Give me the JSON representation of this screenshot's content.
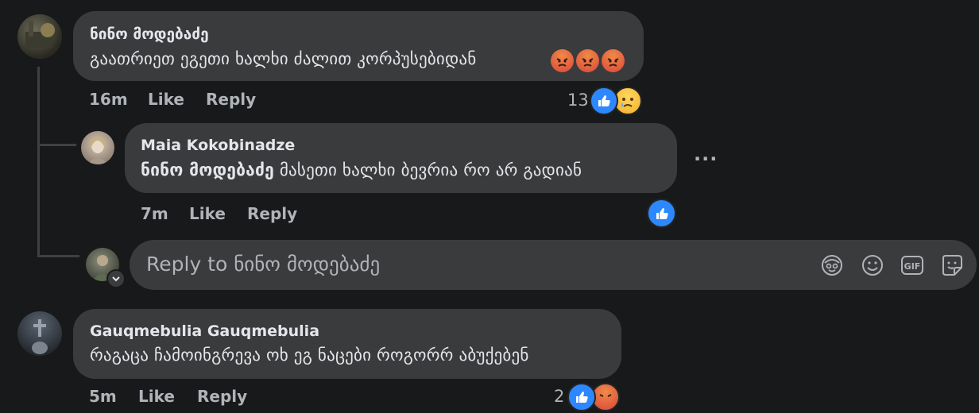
{
  "comments": [
    {
      "author": "ნინო მოდებაძე",
      "text": "გაათრიეთ ეგეთი ხალხი ძალით კორპუსებიდან",
      "time": "16m",
      "like_label": "Like",
      "reply_label": "Reply",
      "reaction_count": "13",
      "reactions": [
        "like",
        "sad"
      ],
      "inline_emojis": [
        "angry-face",
        "angry-face",
        "angry-face"
      ]
    },
    {
      "author": "Maia Kokobinadze",
      "mention": "ნინო მოდებაძე",
      "text": "მასეთი ხალხი ბევრია რო არ გადიან",
      "time": "7m",
      "like_label": "Like",
      "reply_label": "Reply",
      "reactions": [
        "like"
      ],
      "more_label": "..."
    },
    {
      "author": "Gauqmebulia Gauqmebulia",
      "text": "რაგაცა ჩამოინგრევა ოხ ეგ ნაცები როგორრ აბუქებენ",
      "time": "5m",
      "like_label": "Like",
      "reply_label": "Reply",
      "reaction_count": "2",
      "reactions": [
        "like",
        "angry"
      ]
    }
  ],
  "reply_box": {
    "placeholder": "Reply to ნინო მოდებაძე",
    "tools": [
      "avatar-sticker-icon",
      "emoji-icon",
      "gif-icon",
      "sticker-icon"
    ]
  },
  "colors": {
    "background": "#18191a",
    "bubble": "#3a3b3c",
    "text": "#e4e6eb",
    "secondary_text": "#b0b3b8",
    "like_blue": "#2d88ff",
    "angry_red": "#e9710f"
  }
}
